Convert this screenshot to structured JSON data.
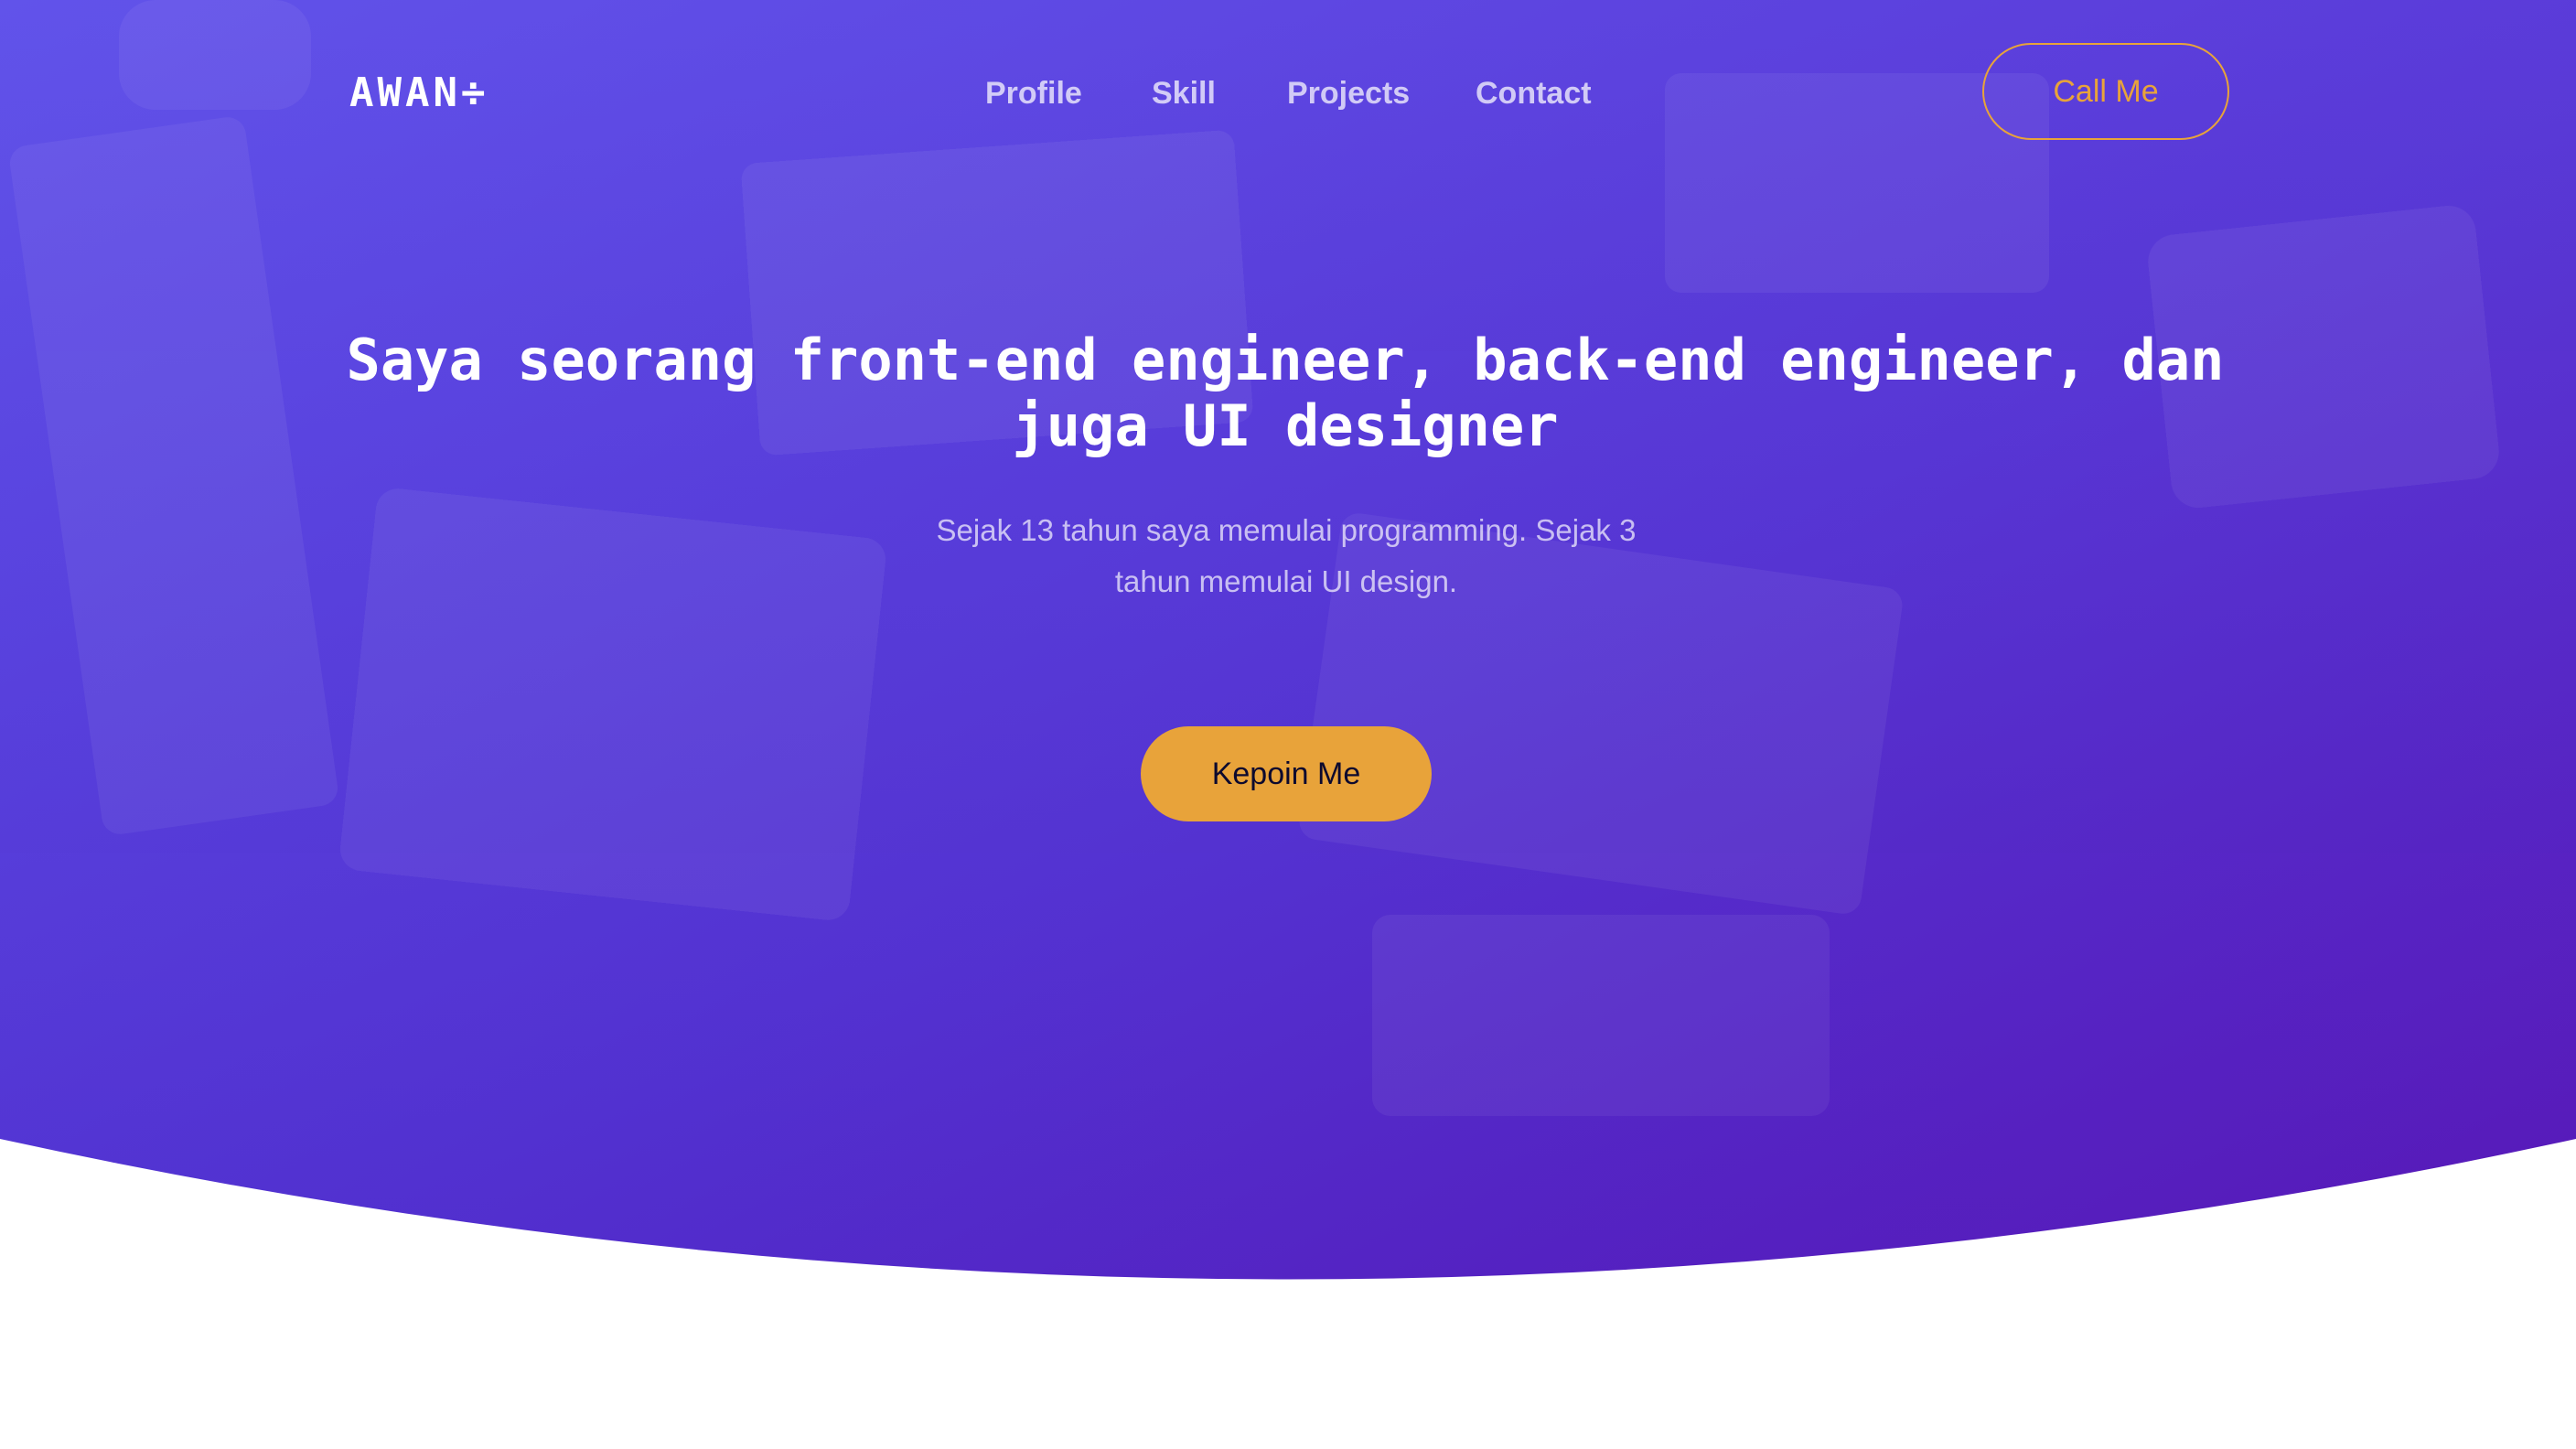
{
  "brand": {
    "logo_text": "AWAN÷"
  },
  "nav": {
    "items": [
      {
        "label": "Profile"
      },
      {
        "label": "Skill"
      },
      {
        "label": "Projects"
      },
      {
        "label": "Contact"
      }
    ]
  },
  "header": {
    "call_label": "Call Me"
  },
  "hero": {
    "headline_line1": "Saya seorang front-end engineer, back-end engineer, dan",
    "headline_line2": "juga UI designer",
    "sub_line1": "Sejak 13 tahun saya memulai programming. Sejak 3",
    "sub_line2": "tahun memulai UI design.",
    "cta_label": "Kepoin Me"
  },
  "colors": {
    "gradient_start": "#5a4ae6",
    "gradient_end": "#5a1bbf",
    "accent": "#e8a33a",
    "background": "#ffffff"
  }
}
